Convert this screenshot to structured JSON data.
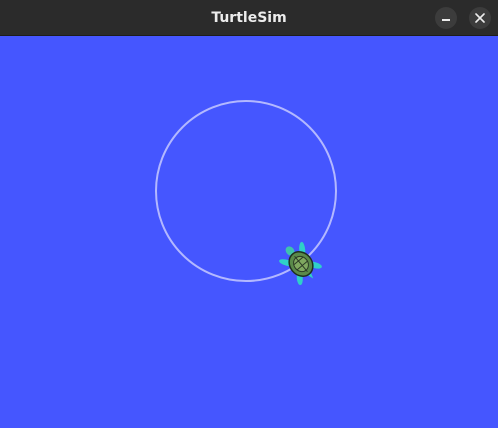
{
  "window": {
    "title": "TurtleSim",
    "buttons": {
      "minimize": "minimize-icon",
      "close": "close-icon"
    }
  },
  "canvas": {
    "background_color": "#4556ff",
    "pen_color": "#b3b8ff",
    "turtle_icon": "turtle-icon"
  }
}
